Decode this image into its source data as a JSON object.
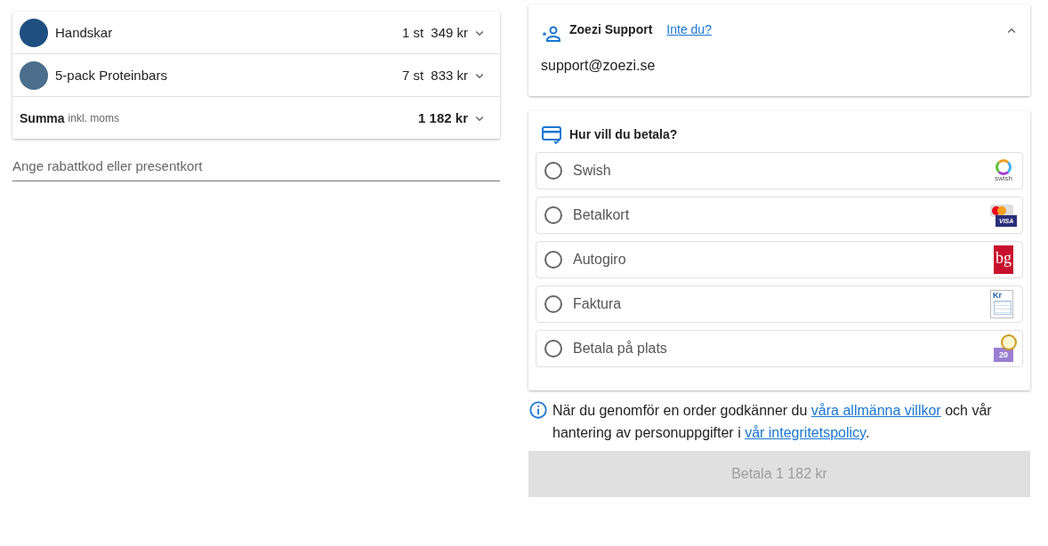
{
  "cart": {
    "items": [
      {
        "name": "Handskar",
        "quantity": "1 st",
        "price": "349 kr",
        "expanded": false
      },
      {
        "name": "5-pack Proteinbars",
        "quantity": "7 st",
        "price": "833 kr",
        "expanded": false
      }
    ],
    "total": {
      "label": "Summa",
      "note": "inkl. moms",
      "amount": "1 182 kr",
      "expanded": false
    }
  },
  "discount_field": {
    "placeholder": "Ange rabattkod eller presentkort"
  },
  "support": {
    "name": "Zoezi Support",
    "link": "Inte du?",
    "email": "support@zoezi.se",
    "expanded": true
  },
  "payment": {
    "title": "Hur vill du betala?",
    "methods": [
      {
        "label": "Swish",
        "kind": "swish",
        "logo_text": "swish",
        "selected": false
      },
      {
        "label": "Betalkort",
        "kind": "card",
        "logo_text": "VISA",
        "selected": false
      },
      {
        "label": "Autogiro",
        "kind": "autogiro",
        "logo_text": "bg",
        "selected": false
      },
      {
        "label": "Faktura",
        "kind": "invoice",
        "logo_text": "Kr",
        "selected": false
      },
      {
        "label": "Betala på plats",
        "kind": "cash",
        "logo_text": "20",
        "selected": false
      }
    ]
  },
  "terms": {
    "before": "När du genomför en order godkänner du",
    "link1": "våra allmänna villkor",
    "middle": "och vår hantering av personuppgifter i",
    "link2": "vår integritetspolicy",
    "after": "."
  },
  "pay_button": {
    "label": "Betala 1 182 kr",
    "disabled": true
  }
}
